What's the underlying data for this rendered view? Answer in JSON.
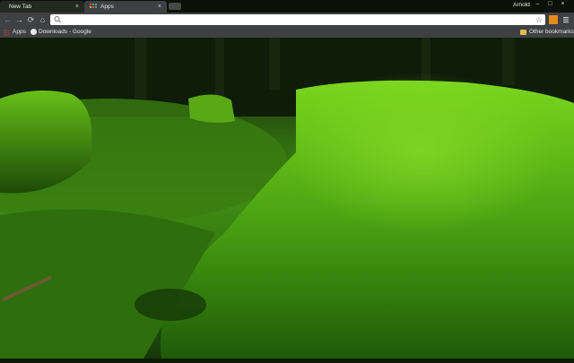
{
  "tabs": [
    {
      "title": "New Tab"
    },
    {
      "title": "Apps"
    }
  ],
  "tab_close_glyph": "×",
  "user": {
    "name": "Arnold"
  },
  "window_controls": {
    "minimize": "–",
    "maximize": "□",
    "close": "×"
  },
  "toolbar": {
    "back_glyph": "←",
    "forward_glyph": "→",
    "reload_glyph": "⟳",
    "home_glyph": "⌂",
    "omnibox_value": "",
    "star_glyph": "☆",
    "icons": [
      "search-icon",
      "star-icon",
      "extension-icon",
      "menu-icon"
    ]
  },
  "bookmarks": {
    "apps": "Apps",
    "downloads": "Downloads - Google",
    "other": "Other bookmarks"
  },
  "theme": {
    "accent": "#3f4044",
    "extension_color": "#e88a19"
  }
}
